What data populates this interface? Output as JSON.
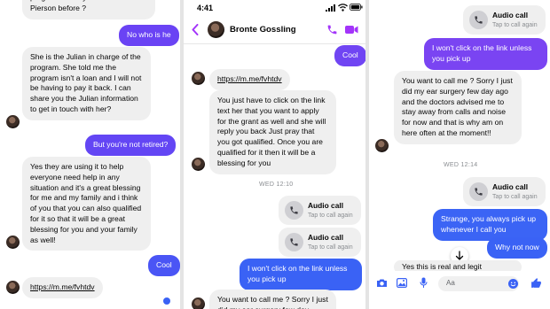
{
  "panel1": {
    "top_text": "program. Have you heard of Julian Pierson before ?",
    "msg_no_who": "No who is he",
    "msg_julian": "She is the Julian in charge of the program. She told me the program isn't a loan and I will not be having to pay it back. I can share you the Julian information to get in touch with her?",
    "msg_not_retired": "But you're not retired?",
    "msg_yes_using": "Yes they are using it to help everyone need help in any situation and it's a great blessing for me and my family and i think of you that you can also qualified for it so that it will be a great blessing for you and your family as well!",
    "msg_cool": "Cool",
    "link": "https://m.me/fvhtdv"
  },
  "panel2": {
    "time": "4:41",
    "contact_name": "Bronte Gossling",
    "msg_cool": "Cool",
    "link": "https://m.me/fvhtdv",
    "msg_click_link": "You just have to click on the link  text her that you want to apply for the grant as well and she will reply you back Just pray that you got qualified. Once you are qualified for it then it will be a blessing for you",
    "timestamp": "WED 12:10",
    "call1_title": "Audio call",
    "call1_sub": "Tap to call again",
    "call2_title": "Audio call",
    "call2_sub": "Tap to call again",
    "msg_wont_click": "I won't click on the link unless you pick up",
    "msg_want_call": "You want to call me ? Sorry I just did my ear surgery few day"
  },
  "panel3": {
    "call_top_title": "Audio call",
    "call_top_sub": "Tap to call again",
    "msg_wont_click": "I won't click on the link unless you pick up",
    "msg_surgery": "You want to call me ? Sorry I just did my ear surgery few day ago and the doctors advised me to stay away from calls and noise for now and that is why am on here often at the moment!!",
    "timestamp": "WED 12:14",
    "call_title": "Audio call",
    "call_sub": "Tap to call again",
    "msg_strange": "Strange, you always pick up whenever I call you",
    "msg_why_not": "Why not now",
    "msg_real": "Yes this is real and legit",
    "input_placeholder": "Aa"
  },
  "colors": {
    "outgoing_purple": "#7045f3",
    "outgoing_blue": "#3a62f5",
    "incoming_bg": "#efefef",
    "messenger_accent": "#a334fa"
  },
  "icons": [
    "back-chevron-icon",
    "phone-icon",
    "video-camera-icon",
    "camera-icon",
    "photo-icon",
    "microphone-icon",
    "emoji-icon",
    "thumbs-up-icon",
    "scroll-down-arrow-icon",
    "signal-icon",
    "wifi-icon",
    "battery-icon"
  ]
}
